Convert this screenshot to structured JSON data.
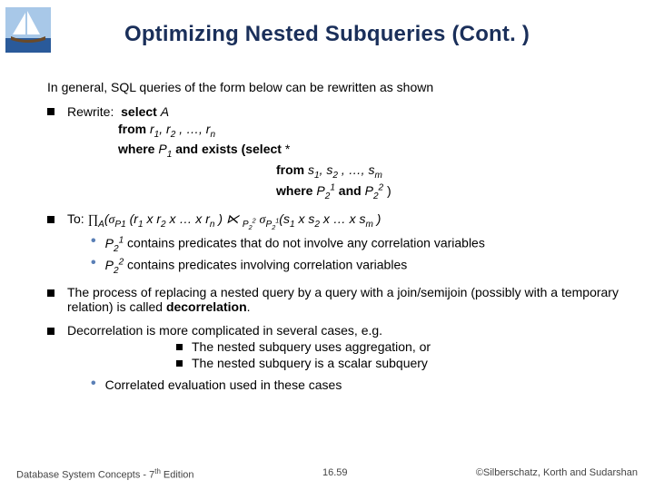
{
  "title": "Optimizing Nested Subqueries (Cont. )",
  "intro": "In general, SQL queries of the form below can be rewritten as shown",
  "rewrite": {
    "label": "Rewrite:",
    "l1a": "select ",
    "l1b": "A",
    "l2a": "from ",
    "l2b": "r",
    "l2c": ", r",
    "l2d": " , …, r",
    "l3a": "where ",
    "l3b": "P",
    "l3c": " and exists (select ",
    "l3d": "*",
    "l4a": "from ",
    "l4b": "s",
    "l4c": ", s",
    "l4d": " , …, s",
    "l5a": "where ",
    "l5b": "P",
    "l5c": " and ",
    "l5d": "P",
    "l5e": " )"
  },
  "to": {
    "label": "To:",
    "s1a": " contains predicates that do not involve any correlation variables",
    "s2a": " contains predicates involving correlation variables"
  },
  "process": {
    "t1": "The process of replacing a nested query by a query with a join/semijoin (possibly with a temporary relation) is called ",
    "t2": "decorrelation",
    "t3": "."
  },
  "decor": {
    "t1": "Decorrelation is more complicated in several cases, e.g.",
    "n1": "The nested subquery uses aggregation, or",
    "n2": "The nested subquery is a scalar subquery",
    "n3": "Correlated evaluation used in these cases"
  },
  "footer": {
    "left": "Database System Concepts - 7",
    "left2": " Edition",
    "mid": "16.59",
    "right": "©Silberschatz, Korth and Sudarshan"
  }
}
